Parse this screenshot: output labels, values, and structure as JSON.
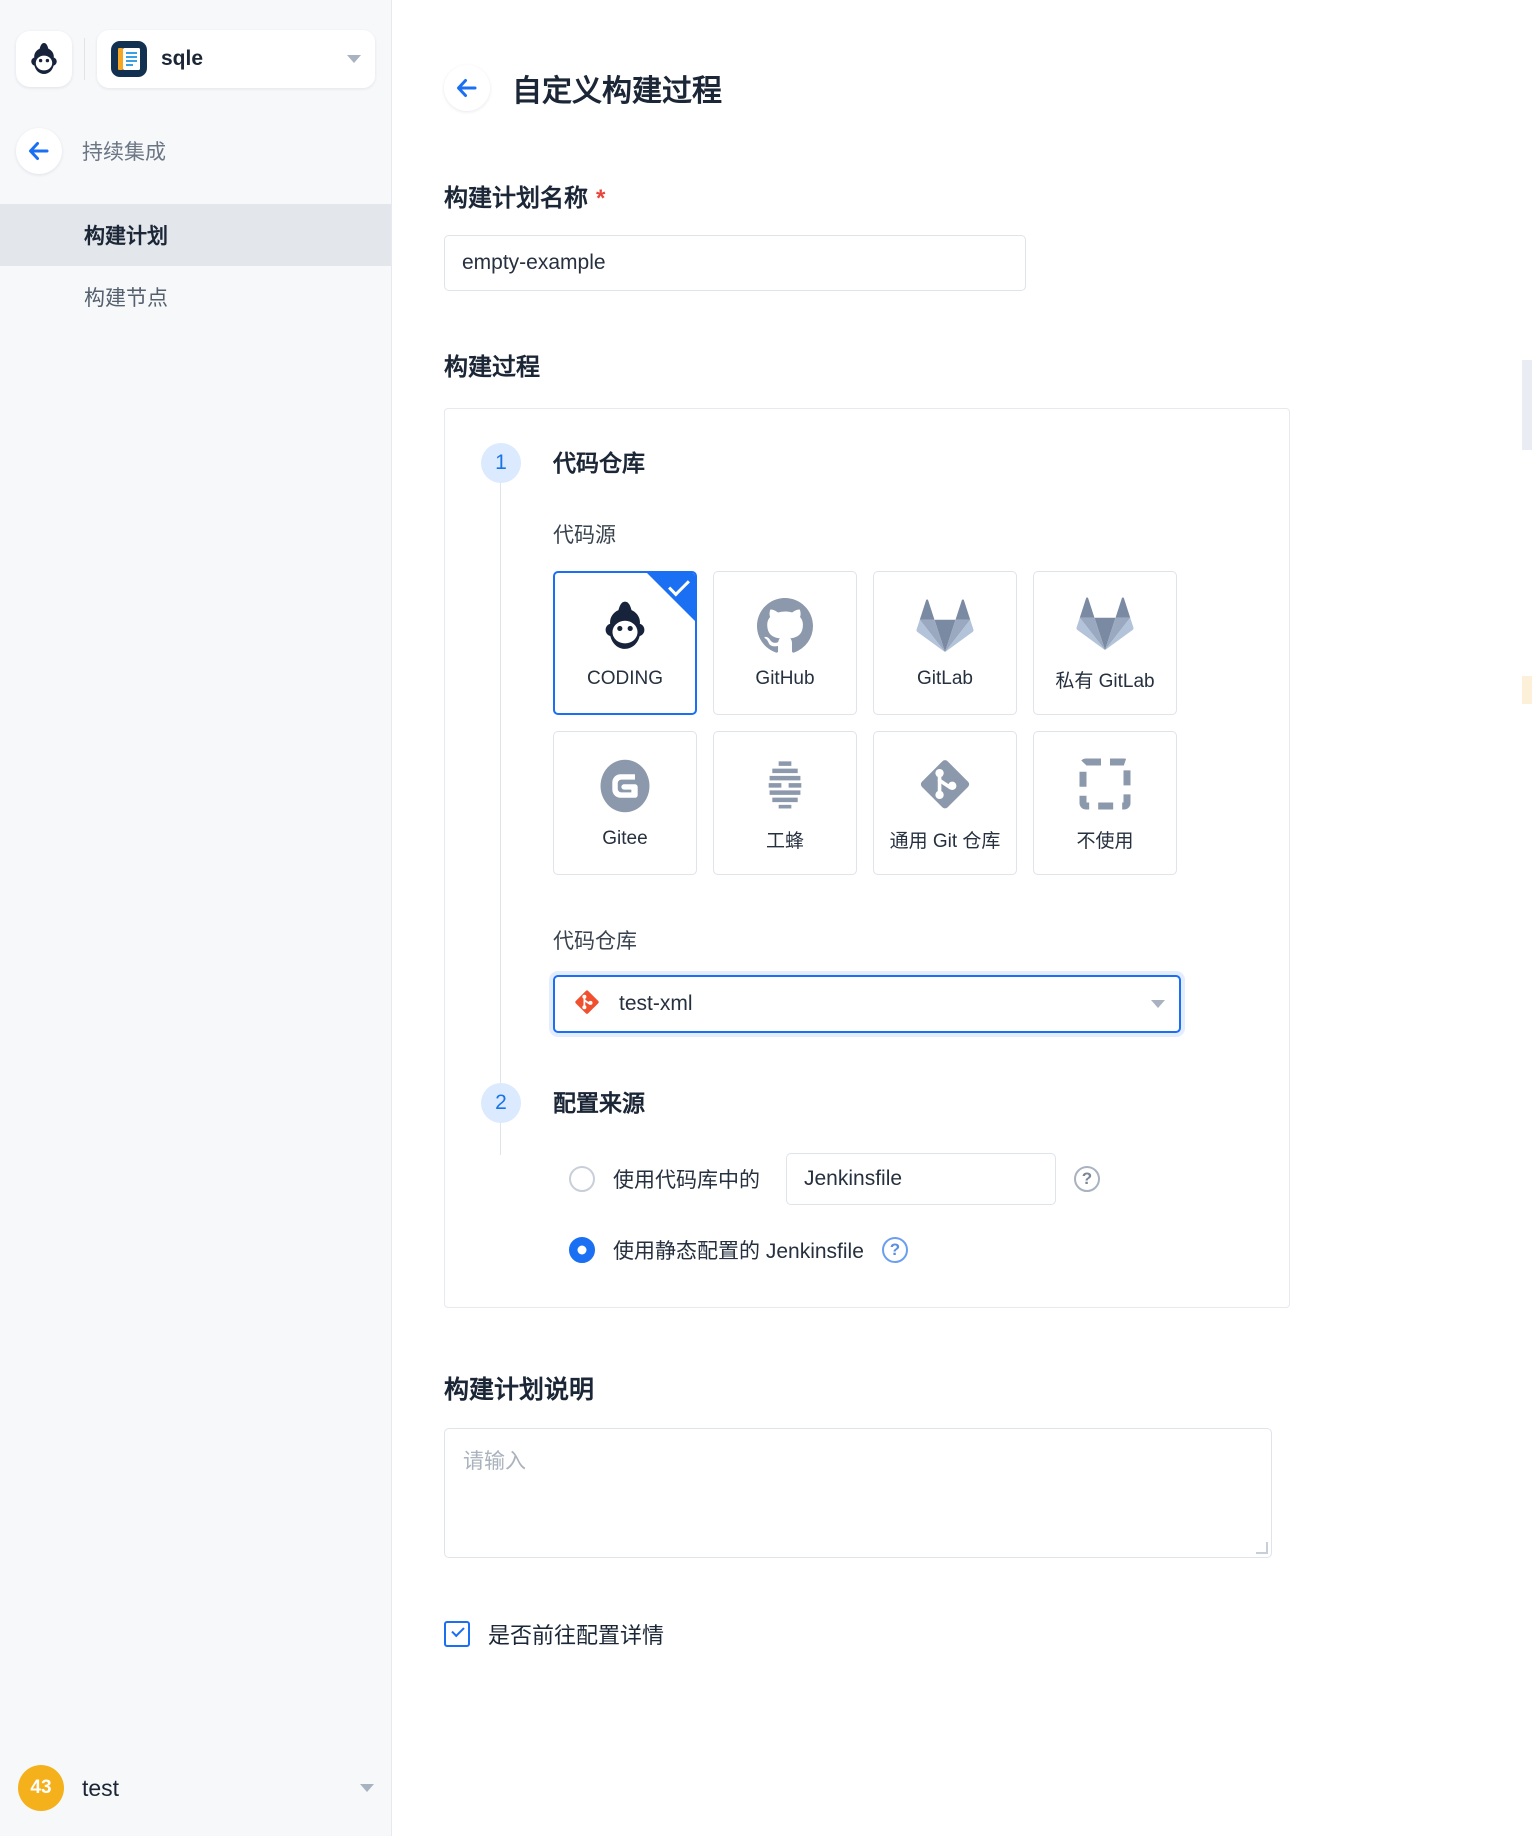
{
  "sidebar": {
    "logo_icon": "coding-monkey-logo",
    "project": {
      "name": "sqle",
      "icon": "project-book-icon",
      "caret": "chevron-down-icon"
    },
    "back": {
      "label": "持续集成",
      "icon": "arrow-left-icon"
    },
    "nav": [
      {
        "label": "构建计划",
        "active": true
      },
      {
        "label": "构建节点",
        "active": false
      }
    ],
    "user": {
      "avatar_text": "43",
      "name": "test",
      "caret": "chevron-down-icon"
    }
  },
  "main": {
    "back_icon": "arrow-left-icon",
    "title": "自定义构建过程",
    "plan_name": {
      "label": "构建计划名称",
      "required_mark": "*",
      "value": "empty-example"
    },
    "process": {
      "section_title": "构建过程"
    },
    "step1": {
      "number": "1",
      "title": "代码仓库",
      "source_label": "代码源",
      "sources": [
        {
          "label": "CODING",
          "icon": "coding-monkey-icon",
          "selected": true
        },
        {
          "label": "GitHub",
          "icon": "github-icon",
          "selected": false
        },
        {
          "label": "GitLab",
          "icon": "gitlab-icon",
          "selected": false
        },
        {
          "label": "私有 GitLab",
          "icon": "gitlab-icon",
          "selected": false
        },
        {
          "label": "Gitee",
          "icon": "gitee-icon",
          "selected": false
        },
        {
          "label": "工蜂",
          "icon": "gongfeng-icon",
          "selected": false
        },
        {
          "label": "通用 Git 仓库",
          "icon": "git-diamond-icon",
          "selected": false
        },
        {
          "label": "不使用",
          "icon": "dashed-square-icon",
          "selected": false
        }
      ],
      "repo_label": "代码仓库",
      "repo_value": "test-xml",
      "repo_icon": "git-diamond-red-icon",
      "repo_caret": "chevron-down-icon"
    },
    "step2": {
      "number": "2",
      "title": "配置来源",
      "option_repo": {
        "label": "使用代码库中的",
        "value": "Jenkinsfile",
        "selected": false,
        "help_icon": "question-mark-icon"
      },
      "option_static": {
        "label": "使用静态配置的 Jenkinsfile",
        "selected": true,
        "help_icon": "question-mark-icon"
      }
    },
    "description": {
      "title": "构建计划说明",
      "placeholder": "请输入",
      "value": ""
    },
    "footer_checkbox": {
      "label": "是否前往配置详情",
      "checked": true
    }
  },
  "colors": {
    "accent": "#1a6ff2",
    "required": "#e8453c",
    "sidebar_bg": "#f7f8fa",
    "avatar": "#f5b11b",
    "git_red": "#f1502f"
  }
}
